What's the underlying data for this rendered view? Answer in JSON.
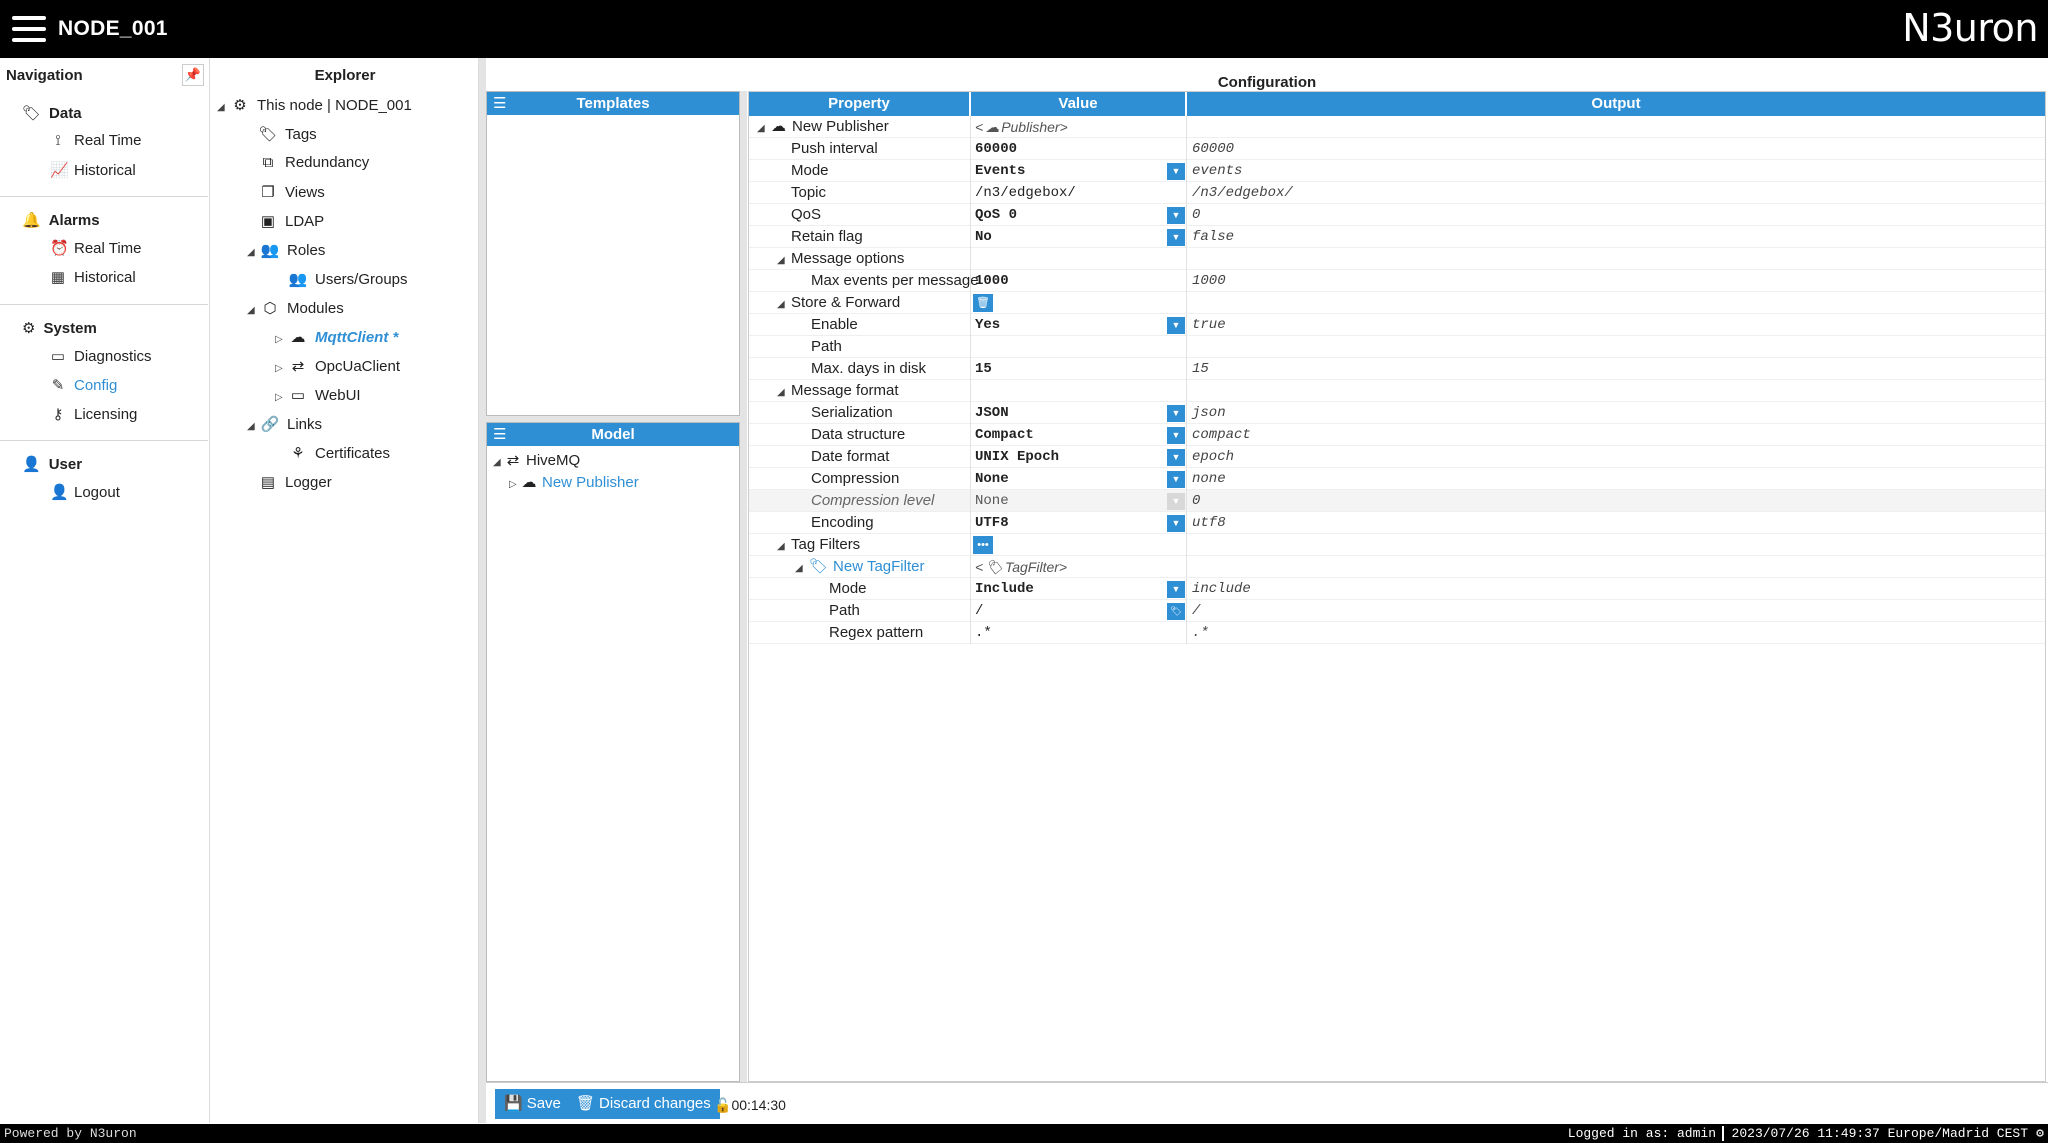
{
  "header": {
    "node_title": "NODE_001",
    "brand": "N3uron"
  },
  "navigation": {
    "title": "Navigation",
    "sections": [
      {
        "label": "Data",
        "icon": "tag-icon",
        "items": [
          {
            "label": "Real Time",
            "icon": "rss-icon"
          },
          {
            "label": "Historical",
            "icon": "line-chart-icon"
          }
        ]
      },
      {
        "label": "Alarms",
        "icon": "bell-icon",
        "items": [
          {
            "label": "Real Time",
            "icon": "alarm-realtime-icon"
          },
          {
            "label": "Historical",
            "icon": "table-icon"
          }
        ]
      },
      {
        "label": "System",
        "icon": "gear-icon",
        "items": [
          {
            "label": "Diagnostics",
            "icon": "diagnostics-icon"
          },
          {
            "label": "Config",
            "icon": "edit-icon",
            "active": true
          },
          {
            "label": "Licensing",
            "icon": "key-icon"
          }
        ]
      },
      {
        "label": "User",
        "icon": "user-icon",
        "items": [
          {
            "label": "Logout",
            "icon": "logout-icon"
          }
        ]
      }
    ]
  },
  "explorer": {
    "title": "Explorer",
    "nodes": [
      {
        "label": "This node | NODE_001"
      },
      {
        "label": "Tags"
      },
      {
        "label": "Redundancy"
      },
      {
        "label": "Views"
      },
      {
        "label": "LDAP"
      },
      {
        "label": "Roles"
      },
      {
        "label": "Users/Groups"
      },
      {
        "label": "Modules"
      },
      {
        "label": "MqttClient *"
      },
      {
        "label": "OpcUaClient"
      },
      {
        "label": "WebUI"
      },
      {
        "label": "Links"
      },
      {
        "label": "Certificates"
      },
      {
        "label": "Logger"
      }
    ]
  },
  "templates": {
    "title": "Templates"
  },
  "model": {
    "title": "Model",
    "nodes": [
      {
        "label": "HiveMQ"
      },
      {
        "label": "New Publisher"
      }
    ]
  },
  "configuration": {
    "title": "Configuration",
    "columns": {
      "property": "Property",
      "value": "Value",
      "output": "Output"
    },
    "rows": [
      {
        "property": "New Publisher",
        "value": "<",
        "value_italic": "Publisher>",
        "output": ""
      },
      {
        "property": "Push interval",
        "value": "60000",
        "output": "60000"
      },
      {
        "property": "Mode",
        "value": "Events",
        "output": "events"
      },
      {
        "property": "Topic",
        "value": "/n3/edgebox/",
        "output": "/n3/edgebox/"
      },
      {
        "property": "QoS",
        "value": "QoS 0",
        "output": "0"
      },
      {
        "property": "Retain flag",
        "value": "No",
        "output": "false"
      },
      {
        "property": "Message options",
        "value": "",
        "output": ""
      },
      {
        "property": "Max events per message",
        "value": "1000",
        "output": "1000"
      },
      {
        "property": "Store & Forward",
        "value": "",
        "output": ""
      },
      {
        "property": "Enable",
        "value": "Yes",
        "output": "true"
      },
      {
        "property": "Path",
        "value": "",
        "output": ""
      },
      {
        "property": "Max. days in disk",
        "value": "15",
        "output": "15"
      },
      {
        "property": "Message format",
        "value": "",
        "output": ""
      },
      {
        "property": "Serialization",
        "value": "JSON",
        "output": "json"
      },
      {
        "property": "Data structure",
        "value": "Compact",
        "output": "compact"
      },
      {
        "property": "Date format",
        "value": "UNIX Epoch",
        "output": "epoch"
      },
      {
        "property": "Compression",
        "value": "None",
        "output": "none"
      },
      {
        "property": "Compression level",
        "value": "None",
        "output": "0"
      },
      {
        "property": "Encoding",
        "value": "UTF8",
        "output": "utf8"
      },
      {
        "property": "Tag Filters",
        "value": "",
        "output": ""
      },
      {
        "property": "New TagFilter",
        "value": "<",
        "value_italic": "TagFilter>",
        "output": ""
      },
      {
        "property": "Mode",
        "value": "Include",
        "output": "include"
      },
      {
        "property": "Path",
        "value": "/",
        "output": "/"
      },
      {
        "property": "Regex pattern",
        "value": ".*",
        "output": ".*"
      }
    ]
  },
  "actions": {
    "save": "Save",
    "discard": "Discard changes",
    "timer": "00:14:30"
  },
  "status_bar": {
    "powered": "Powered by N3uron",
    "login": "Logged in as: admin",
    "clock": "2023/07/26 11:49:37 Europe/Madrid CEST"
  },
  "colors": {
    "accent": "#2f8fd5",
    "header_bg": "#000000"
  }
}
